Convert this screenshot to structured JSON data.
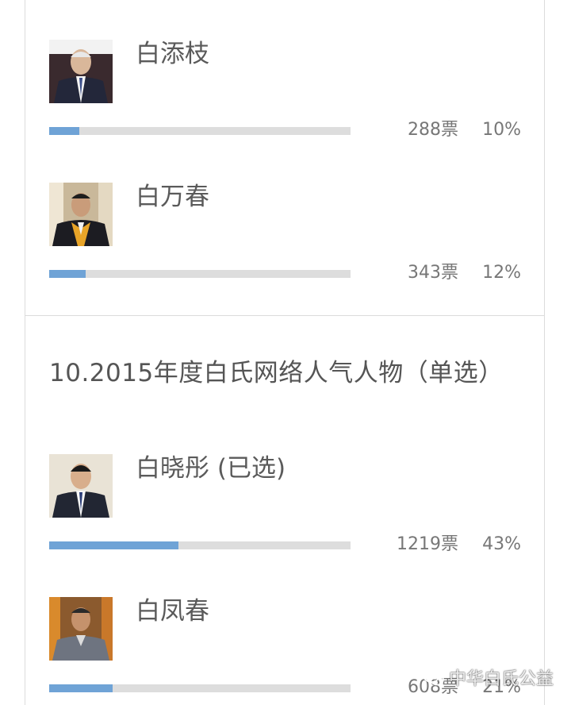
{
  "poll_top": {
    "candidates": [
      {
        "name": "白添枝",
        "votes_label": "288票",
        "percent_label": "10%",
        "percent": 10
      },
      {
        "name": "白万春",
        "votes_label": "343票",
        "percent_label": "12%",
        "percent": 12
      }
    ]
  },
  "poll_bottom": {
    "question": "10.2015年度白氏网络人气人物（单选）",
    "candidates": [
      {
        "name": "白晓彤 (已选)",
        "votes_label": "1219票",
        "percent_label": "43%",
        "percent": 43
      },
      {
        "name": "白凤春",
        "votes_label": "608票",
        "percent_label": "21%",
        "percent": 21
      }
    ]
  },
  "watermark": {
    "text": "中华白氏公益",
    "icon": "wechat-icon"
  },
  "colors": {
    "bar_fill": "#6fa3d6",
    "bar_track": "#dddddd",
    "text": "#5a5a5a",
    "border": "#dcdcdc"
  }
}
